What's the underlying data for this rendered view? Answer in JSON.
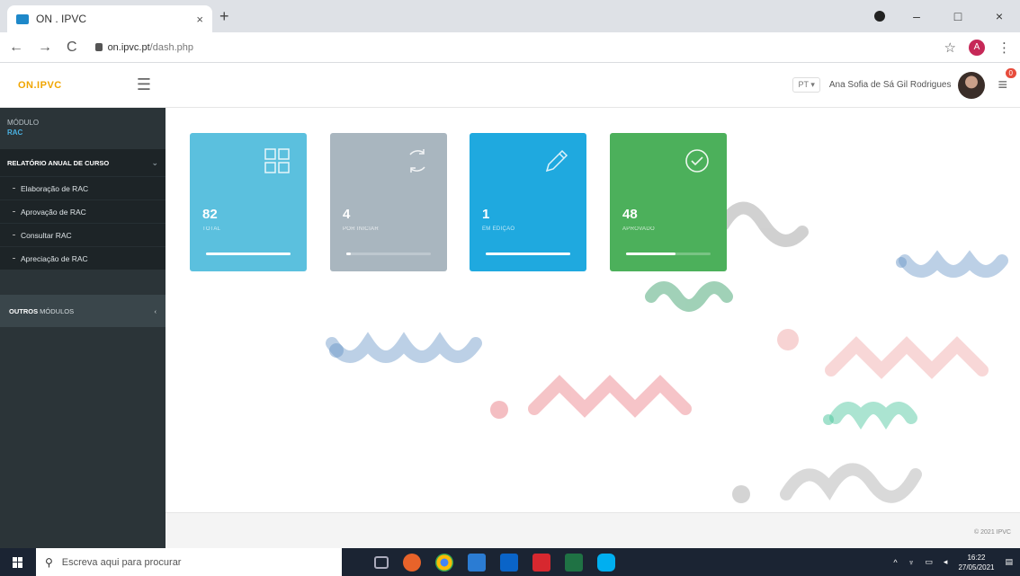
{
  "browser": {
    "tab_title": "ON . IPVC",
    "tab_close": "×",
    "new_tab": "+",
    "url_domain": "on.ipvc.pt",
    "url_path": "/dash.php",
    "back": "←",
    "forward": "→",
    "reload": "C",
    "bookmark": "☆",
    "account_initial": "A",
    "menu": "⋮",
    "minimize": "–",
    "maximize": "□",
    "close": "×"
  },
  "header": {
    "logo": "ON.IPVC",
    "language": "PT ▾",
    "user_name": "Ana Sofia de Sá Gil Rodrigues",
    "notifications_count": "0"
  },
  "sidebar": {
    "module_label": "MÓDULO",
    "module_name": "RAC",
    "section_title": "RELATÓRIO ANUAL DE CURSO",
    "items": [
      {
        "label": "Elaboração de RAC"
      },
      {
        "label": "Aprovação de RAC"
      },
      {
        "label": "Consultar RAC"
      },
      {
        "label": "Apreciação de RAC"
      }
    ],
    "other_bold": "OUTROS",
    "other_rest": " MÓDULOS"
  },
  "cards": [
    {
      "value": "82",
      "label": "TOTAL",
      "color": "#5bc0de",
      "progress": 1.0,
      "icon": "grid-icon"
    },
    {
      "value": "4",
      "label": "POR INICIAR",
      "color": "#a9b6bf",
      "progress": 0.05,
      "icon": "refresh-icon"
    },
    {
      "value": "1",
      "label": "EM EDIÇÃO",
      "color": "#1fa9df",
      "progress": 1.0,
      "icon": "pencil-icon"
    },
    {
      "value": "48",
      "label": "APROVADO",
      "color": "#4cb05b",
      "progress": 0.59,
      "icon": "check-circle-icon"
    }
  ],
  "footer": {
    "copyright": "© 2021 IPVC"
  },
  "taskbar": {
    "search_placeholder": "Escreva aqui para procurar",
    "time": "16:22",
    "date": "27/05/2021"
  },
  "colors": {
    "sidebar_bg": "#2b3438",
    "accent_blue": "#4ab0e0",
    "logo_orange": "#f0a500"
  }
}
